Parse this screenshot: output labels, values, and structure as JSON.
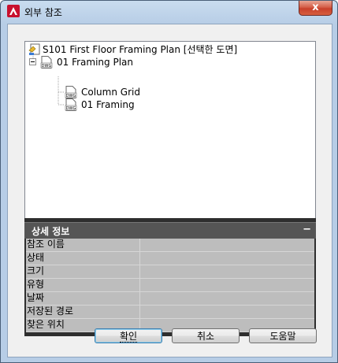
{
  "window": {
    "title": "외부 참조",
    "close_label": "x"
  },
  "icons": {
    "app": "autocad-app-icon",
    "close": "close-icon",
    "drawing": "drawing-sheet-icon",
    "dwg": "dwg-file-icon",
    "collapse_tree": "minus-box-icon"
  },
  "tree": {
    "root_label": "S101 First Floor Framing Plan [선택한 도면]",
    "child_label": "01 Framing Plan",
    "grandchildren": [
      {
        "label": "Column Grid"
      },
      {
        "label": "01 Framing"
      }
    ],
    "dwg_badge": "DWG"
  },
  "details": {
    "header": "상세 정보",
    "collapse_label": "−",
    "rows": [
      {
        "name": "참조 이름",
        "value": ""
      },
      {
        "name": "상태",
        "value": ""
      },
      {
        "name": "크기",
        "value": ""
      },
      {
        "name": "유형",
        "value": ""
      },
      {
        "name": "날짜",
        "value": ""
      },
      {
        "name": "저장된 경로",
        "value": ""
      },
      {
        "name": "찾은 위치",
        "value": ""
      }
    ]
  },
  "buttons": {
    "ok": "확인",
    "cancel": "취소",
    "help": "도움말"
  },
  "colors": {
    "title_bar": "#b7cde6",
    "close_button": "#c8402b",
    "details_header": "#555555",
    "details_rows": "#bdbdbd",
    "default_button_border": "#3c7fb1"
  }
}
